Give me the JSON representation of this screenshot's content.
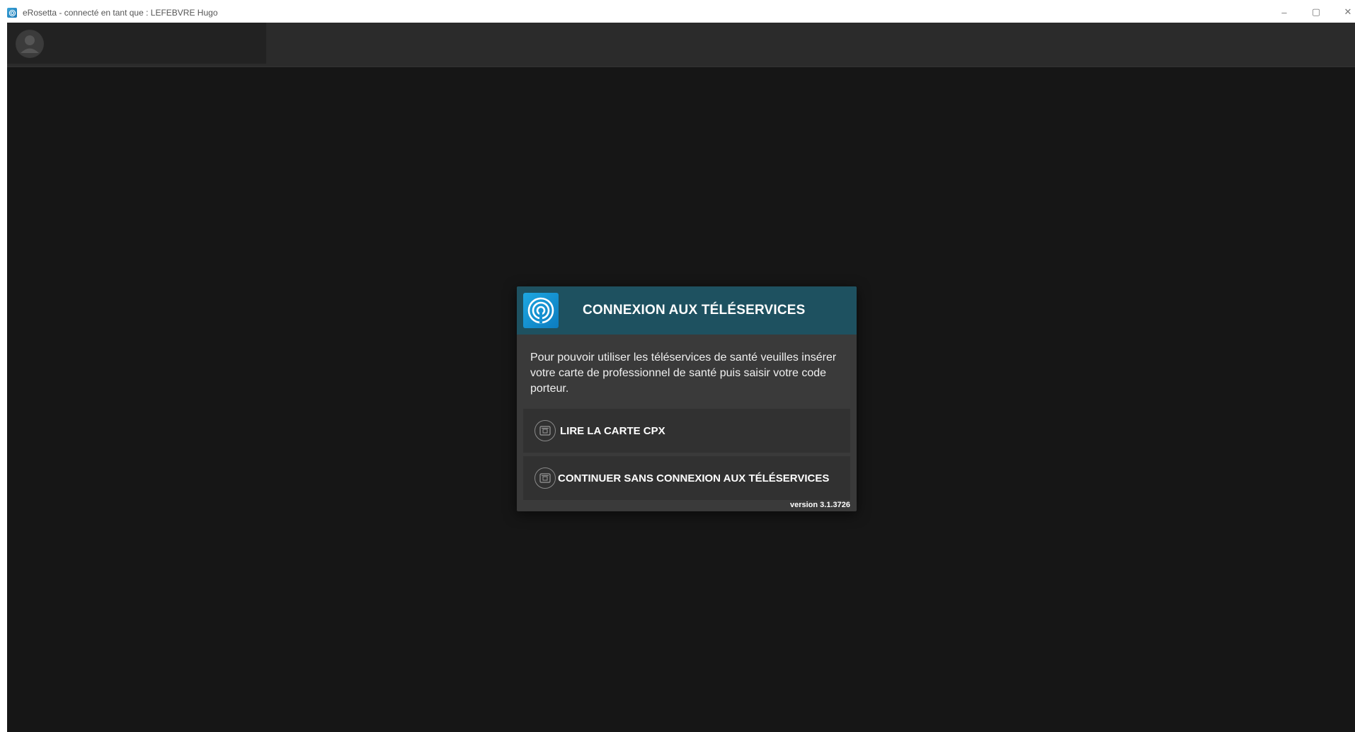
{
  "window": {
    "title": "eRosetta - connecté en tant que : LEFEBVRE Hugo",
    "minimize_glyph": "–",
    "maximize_glyph": "▢",
    "close_glyph": "✕"
  },
  "app": {
    "user_avatar_icon": "user-avatar-icon"
  },
  "dialog": {
    "logo_icon": "teleservice-logo-icon",
    "title": "CONNEXION AUX TÉLÉSERVICES",
    "message": "Pour pouvoir utiliser les téléservices de santé veuilles insérer votre carte de professionnel de santé puis saisir votre code porteur.",
    "buttons": [
      {
        "label": "LIRE LA CARTE CPX",
        "icon": "card-reader-icon"
      },
      {
        "label": "CONTINUER SANS CONNEXION AUX TÉLÉSERVICES",
        "icon": "card-reader-icon"
      }
    ],
    "version": "version 3.1.3726"
  },
  "colors": {
    "header_bg": "#1e5160",
    "dialog_bg": "#3a3a3a",
    "app_bg": "#1b1b1b",
    "logo_blue": "#1ea7e0"
  }
}
